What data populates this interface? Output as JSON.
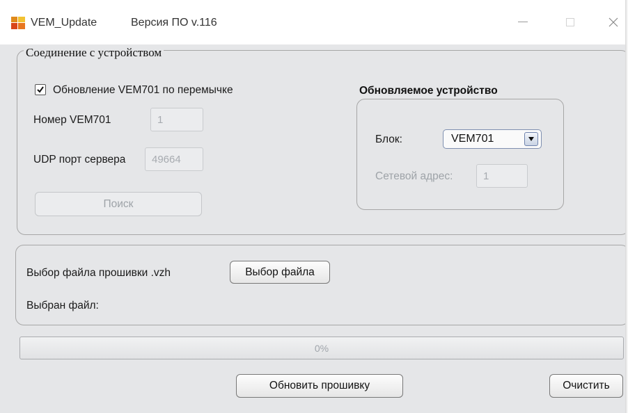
{
  "window": {
    "app_name": "VEM_Update",
    "version": "Версия ПО v.116",
    "minimize_glyph": "—",
    "maximize_glyph": "☐",
    "close_glyph": "✕"
  },
  "connection": {
    "title": "Соединение с устройством",
    "jumper_update": {
      "label": "Обновление VEM701 по перемычке",
      "checked": true
    },
    "vem_number_label": "Номер VEM701",
    "vem_number_value": "1",
    "udp_port_label": "UDP порт сервера",
    "udp_port_value": "49664",
    "search_button": "Поиск"
  },
  "device": {
    "title": "Обновляемое устройство",
    "block_label": "Блок:",
    "block_value": "VEM701",
    "network_address_label": "Сетевой адрес:",
    "network_address_value": "1"
  },
  "firmware": {
    "select_label": "Выбор файла прошивки .vzh",
    "select_button": "Выбор файла",
    "selected_file_label": "Выбран файл:",
    "selected_file_value": ""
  },
  "progress": {
    "fraction": 0,
    "text": "0%"
  },
  "actions": {
    "update_button": "Обновить прошивку",
    "clear_button": "Очистить"
  },
  "colors": {
    "window_bg": "#e5e6e8",
    "titlebar_bg": "#ffffff",
    "group_border": "#a6a6a6",
    "select_border": "#7e8fb0"
  },
  "icons": {
    "app": "app-grid-icon",
    "check": "checkmark-icon",
    "dropdown": "triangle-down-icon"
  }
}
